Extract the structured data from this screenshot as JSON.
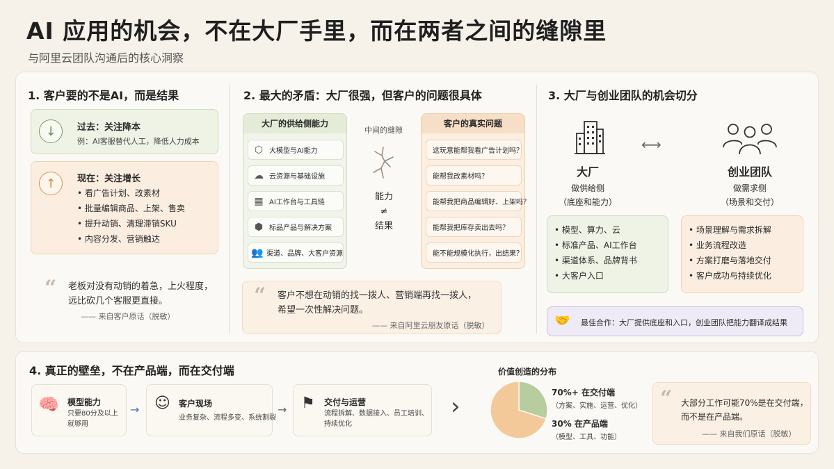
{
  "header": {
    "title": "AI 应用的机会，不在大厂手里，而在两者之间的缝隙里",
    "subtitle": "与阿里云团队沟通后的核心洞察"
  },
  "section1": {
    "title": "1. 客户要的不是AI，而是结果",
    "past": {
      "icon": "arrow-down-icon",
      "label": "过去：关注降本",
      "example": "例：AI客服替代人工，降低人力成本"
    },
    "now": {
      "icon": "arrow-up-icon",
      "label": "现在：关注增长",
      "items": [
        "看广告计划、改素材",
        "批量编辑商品、上架、售卖",
        "提升动销、清理滞销SKU",
        "内容分发、营销触达"
      ]
    },
    "quote": {
      "lines": [
        "老板对没有动销的着急，上火程度，",
        "远比砍几个客服更直接。"
      ],
      "source": "—— 来自客户原话（脱敏）"
    }
  },
  "section2": {
    "title": "2. 最大的矛盾：大厂很强，但客户的问题很具体",
    "supply_title": "大厂的供给侧能力",
    "supply_items": [
      {
        "icon": "cube-icon",
        "label": "大模型与AI能力"
      },
      {
        "icon": "cloud-icon",
        "label": "云资源与基础设施"
      },
      {
        "icon": "grid-icon",
        "label": "AI工作台与工具链"
      },
      {
        "icon": "box-icon",
        "label": "标品产品与解决方案"
      },
      {
        "icon": "people-icon",
        "label": "渠道、品牌、大客户资源"
      }
    ],
    "gap_label": "中间的缝隙",
    "gap_text": [
      "能力",
      "≠",
      "结果"
    ],
    "demand_title": "客户的真实问题",
    "demand_items": [
      "这玩意能帮我看广告计划吗？",
      "能帮我改素材吗？",
      "能帮我把商品编辑好、上架吗？",
      "能帮我把库存卖出去吗？",
      "能不能规模化执行，出结果？"
    ],
    "quote": {
      "lines": [
        "客户不想在动销的找一拨人、营销端再找一拨人，",
        "希望一次性解决问题。"
      ],
      "source": "—— 来自阿里云朋友原话（脱敏）"
    }
  },
  "section3": {
    "title": "3. 大厂与创业团队的机会切分",
    "big": {
      "name": "大厂",
      "role": "做供给侧",
      "role_detail": "（底座和能力）",
      "items": [
        "模型、算力、云",
        "标准产品、AI工作台",
        "渠道体系、品牌背书",
        "大客户入口"
      ]
    },
    "startup": {
      "name": "创业团队",
      "role": "做需求侧",
      "role_detail": "（场景和交付）",
      "items": [
        "场景理解与需求拆解",
        "业务流程改造",
        "方案打磨与落地交付",
        "客户成功与持续优化"
      ]
    },
    "best": "最佳合作：大厂提供底座和入口，创业团队把能力翻译成结果"
  },
  "section4": {
    "title": "4. 真正的壁垒，不在产品端，而在交付端",
    "steps": [
      {
        "icon": "brain-icon",
        "title": "模型能力",
        "desc": [
          "只要80分及以上",
          "就够用"
        ]
      },
      {
        "icon": "person-icon",
        "title": "客户现场",
        "desc": [
          "业务复杂、流程多变、系统割裂"
        ]
      },
      {
        "icon": "flag-icon",
        "title": "交付与运营",
        "desc": [
          "流程拆解、数据接入、员工培训、",
          "持续优化"
        ]
      }
    ],
    "value_title": "价值创造的分布",
    "quote": {
      "lines": [
        "大部分工作可能70%是在交付端，",
        "而不是在产品端。"
      ],
      "source": "—— 来自我们原话（脱敏）"
    }
  },
  "chart_data": {
    "type": "pie",
    "title": "价值创造的分布",
    "slices": [
      {
        "label": "70%+ 在交付端",
        "value": 70,
        "detail": "（方案、实施、运营、优化）",
        "color": "#f3c99a"
      },
      {
        "label": "30% 在产品端",
        "value": 30,
        "detail": "（模型、工具、功能）",
        "color": "#b7cc9f"
      }
    ]
  },
  "colors": {
    "green": "#6f8f55",
    "orange": "#d9893a",
    "purple": "#8b7bb5"
  }
}
